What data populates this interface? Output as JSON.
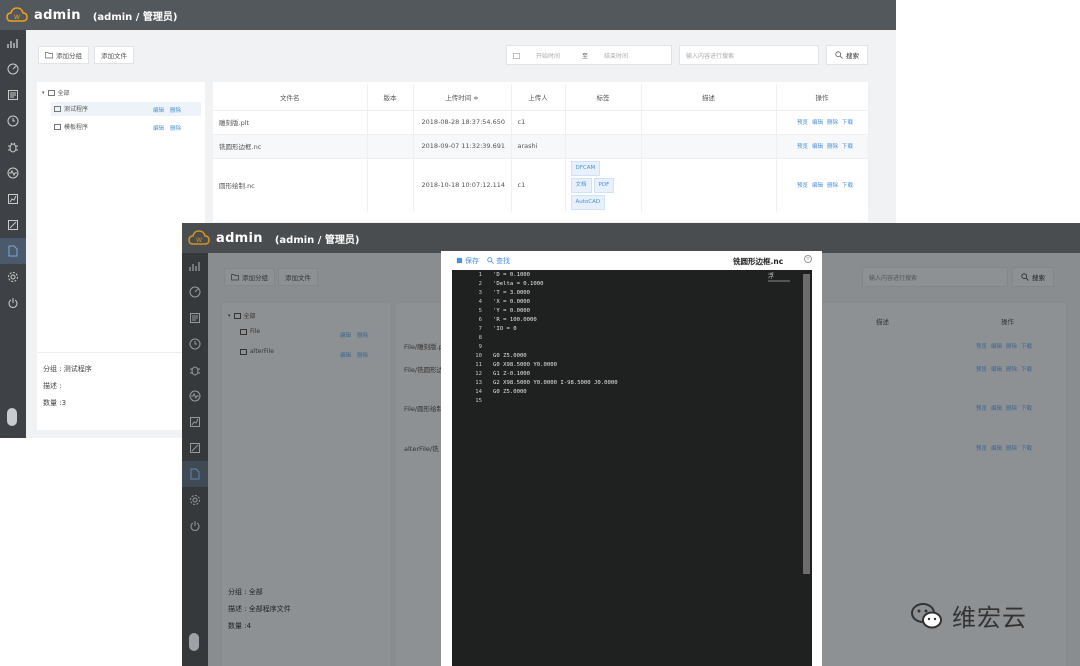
{
  "app": {
    "name": "admin",
    "role": "(admin / 管理员)"
  },
  "back": {
    "toolbar": {
      "add_group": "添加分组",
      "add_file": "添加文件",
      "start_time": "开始时间",
      "range_sep": "至",
      "end_time": "结束时间",
      "search_placeholder": "输入内容进行搜索",
      "search_button": "搜索"
    },
    "tree": {
      "root": "全部",
      "groups": [
        {
          "name": "测试程序",
          "edit": "编辑",
          "delete": "删除"
        },
        {
          "name": "模板程序",
          "edit": "编辑",
          "delete": "删除"
        }
      ]
    },
    "meta": {
      "group": "分组 : 测试程序",
      "desc": "描述 :",
      "count": "数量 :3"
    },
    "table": {
      "headers": [
        "文件名",
        "版本",
        "上传时间 ≑",
        "上传人",
        "标签",
        "描述",
        "操作"
      ],
      "rows": [
        {
          "name": "雕刻版.plt",
          "version": "",
          "time": "2018-08-28 18:37:54.650",
          "user": "c1",
          "tags": [],
          "desc": ""
        },
        {
          "name": "铣圆形边框.nc",
          "version": "",
          "time": "2018-09-07 11:32:39.691",
          "user": "arashi",
          "tags": [],
          "desc": ""
        },
        {
          "name": "圆形绘制.nc",
          "version": "",
          "time": "2018-10-18 10:07:12.114",
          "user": "c1",
          "tags": [
            "DFCAM",
            "文档",
            "PDF",
            "AutoCAD"
          ],
          "desc": ""
        }
      ],
      "ops": [
        "预览",
        "编辑",
        "删除",
        "下载"
      ]
    }
  },
  "front": {
    "toolbar": {
      "add_group": "添加分组",
      "add_file": "添加文件",
      "search_placeholder": "输入内容进行搜索",
      "search_button": "搜索"
    },
    "tree": {
      "root": "全部",
      "groups": [
        {
          "name": "File",
          "edit": "编辑",
          "delete": "删除"
        },
        {
          "name": "alterFile",
          "edit": "编辑",
          "delete": "删除"
        }
      ]
    },
    "meta": {
      "group": "分组 : 全部",
      "desc": "描述 : 全部程序文件",
      "count": "数量 :4"
    },
    "table": {
      "header_desc": "描述",
      "header_ops": "操作",
      "rows": [
        "File/雕刻版.p",
        "File/铣圆形边",
        "File/圆形绘制",
        "alterFile/铣"
      ],
      "ops": [
        "预览",
        "编辑",
        "删除",
        "下载"
      ]
    }
  },
  "editor": {
    "save": "保存",
    "find": "查找",
    "title": "铣圆形边框.nc",
    "badge": "浮",
    "lines": [
      {
        "n": "1",
        "code": "'D = 0.1000"
      },
      {
        "n": "2",
        "code": "'Delta = 0.1000"
      },
      {
        "n": "3",
        "code": "'T = 3.0000"
      },
      {
        "n": "4",
        "code": "'X = 0.0000"
      },
      {
        "n": "5",
        "code": "'Y = 0.0000"
      },
      {
        "n": "6",
        "code": "'R = 100.0000"
      },
      {
        "n": "7",
        "code": "'IO = 0"
      },
      {
        "n": "8",
        "code": ""
      },
      {
        "n": "9",
        "code": ""
      },
      {
        "n": "10",
        "code": "G0 Z5.0000"
      },
      {
        "n": "11",
        "code": "G0 X98.5000 Y0.0000"
      },
      {
        "n": "12",
        "code": "G1 Z-0.1000"
      },
      {
        "n": "13",
        "code": "G2 X98.5000 Y0.0000 I-98.5000 J0.0000"
      },
      {
        "n": "14",
        "code": "G0 Z5.0000"
      },
      {
        "n": "15",
        "code": ""
      }
    ]
  },
  "watermark": {
    "text": "维宏云"
  }
}
